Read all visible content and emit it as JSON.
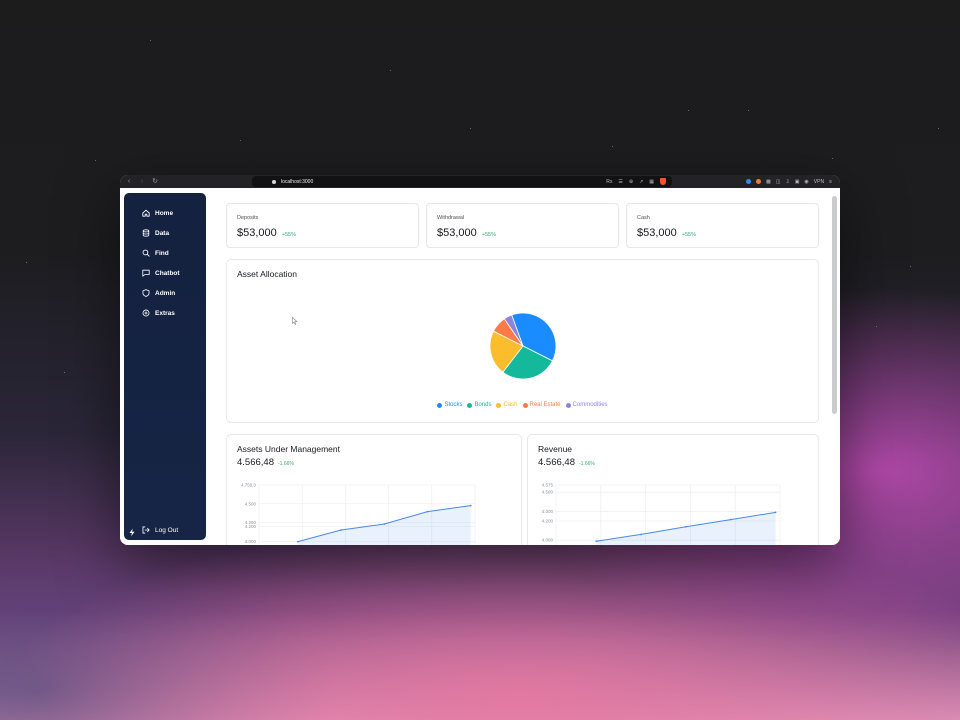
{
  "browser": {
    "url": "localhost:3000",
    "right_items": [
      "Rx",
      "VPN"
    ]
  },
  "sidebar": {
    "items": [
      {
        "label": "Home",
        "icon": "home-icon"
      },
      {
        "label": "Data",
        "icon": "database-icon"
      },
      {
        "label": "Find",
        "icon": "search-icon"
      },
      {
        "label": "Chatbot",
        "icon": "chat-icon"
      },
      {
        "label": "Admin",
        "icon": "shield-icon"
      },
      {
        "label": "Extras",
        "icon": "plus-circle-icon"
      }
    ],
    "logout_label": "Log Out"
  },
  "stats": [
    {
      "label": "Deposits",
      "value": "$53,000",
      "change": "+55%"
    },
    {
      "label": "Withdrawal",
      "value": "$53,000",
      "change": "+55%"
    },
    {
      "label": "Cash",
      "value": "$53,000",
      "change": "+55%"
    }
  ],
  "allocation": {
    "title": "Asset Allocation",
    "chart_data": {
      "type": "pie",
      "slices": [
        {
          "name": "Stocks",
          "value": 38,
          "color": "#1a8cff"
        },
        {
          "name": "Bonds",
          "value": 28,
          "color": "#14b89a"
        },
        {
          "name": "Cash",
          "value": 22,
          "color": "#fbbd2c"
        },
        {
          "name": "Real Estate",
          "value": 8,
          "color": "#ff7a45"
        },
        {
          "name": "Commodities",
          "value": 4,
          "color": "#8b84d7"
        }
      ],
      "legend": "bottom"
    }
  },
  "aum": {
    "title": "Assets Under Management",
    "value": "4.566,48",
    "change": "-1.66%",
    "chart_data": {
      "type": "area",
      "y_ticks": [
        "4.750,0",
        "4.500",
        "4.250",
        "4.200",
        "4.000"
      ],
      "values": [
        3995,
        4150,
        4230,
        4395,
        4475
      ],
      "color": "#4a88e8"
    }
  },
  "revenue": {
    "title": "Revenue",
    "value": "4.566,48",
    "change": "-1.66%",
    "chart_data": {
      "type": "area",
      "y_ticks": [
        "4.575",
        "4.500",
        "4.300",
        "4.200",
        "4.000"
      ],
      "values": [
        3990,
        4060,
        4140,
        4215,
        4290
      ],
      "color": "#4a88e8"
    }
  }
}
